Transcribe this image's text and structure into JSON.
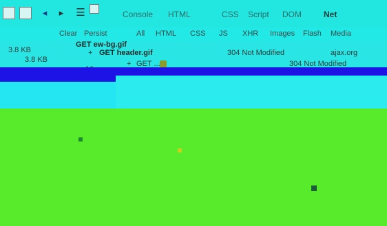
{
  "toolbar": {
    "tabs": [
      {
        "label": "Console"
      },
      {
        "label": "HTML"
      },
      {
        "label": "CSS"
      },
      {
        "label": "Script"
      },
      {
        "label": "DOM"
      },
      {
        "label": "Net"
      }
    ],
    "active_tab": "Net",
    "icons": [
      "inspect-icon",
      "panel-icon",
      "back-icon",
      "forward-icon",
      "menu-icon",
      "close-icon"
    ]
  },
  "net_toolbar": {
    "items": [
      {
        "label": "Clear"
      },
      {
        "label": "Persist"
      },
      {
        "label": "All"
      },
      {
        "label": "HTML"
      },
      {
        "label": "CSS"
      },
      {
        "label": "JS"
      },
      {
        "label": "XHR"
      },
      {
        "label": "Images"
      },
      {
        "label": "Flash"
      },
      {
        "label": "Media"
      }
    ]
  },
  "requests": {
    "rows": [
      {
        "url": "GET ew-bg.gif",
        "status": "",
        "domain": "",
        "size": ""
      },
      {
        "url": "GET header.gif",
        "status": "304 Not Modified",
        "domain": "ajax.org",
        "size": "3.8 KB"
      },
      {
        "url": "GET ...",
        "status": "304 Not Modified",
        "domain": "",
        "size": ""
      }
    ],
    "left_labels": [
      "3.8 KB",
      "10"
    ]
  },
  "colors": {
    "toolbar_bg": "#21e7e0",
    "selection": "#1d13e4",
    "empty_area": "#57eb2c"
  }
}
